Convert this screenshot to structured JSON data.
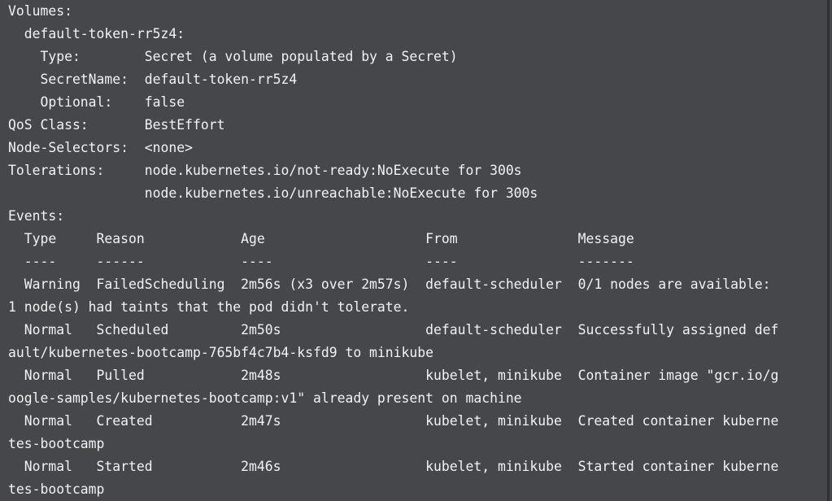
{
  "terminal": {
    "lines": [
      "Volumes:",
      "  default-token-rr5z4:",
      "    Type:        Secret (a volume populated by a Secret)",
      "    SecretName:  default-token-rr5z4",
      "    Optional:    false",
      "QoS Class:       BestEffort",
      "Node-Selectors:  <none>",
      "Tolerations:     node.kubernetes.io/not-ready:NoExecute for 300s",
      "                 node.kubernetes.io/unreachable:NoExecute for 300s",
      "Events:",
      "  Type     Reason            Age                    From               Message",
      "  ----     ------            ----                   ----               -------",
      "  Warning  FailedScheduling  2m56s (x3 over 2m57s)  default-scheduler  0/1 nodes are available:",
      "1 node(s) had taints that the pod didn't tolerate.",
      "  Normal   Scheduled         2m50s                  default-scheduler  Successfully assigned def",
      "ault/kubernetes-bootcamp-765bf4c7b4-ksfd9 to minikube",
      "  Normal   Pulled            2m48s                  kubelet, minikube  Container image \"gcr.io/g",
      "oogle-samples/kubernetes-bootcamp:v1\" already present on machine",
      "  Normal   Created           2m47s                  kubelet, minikube  Created container kuberne",
      "tes-bootcamp",
      "  Normal   Started           2m46s                  kubelet, minikube  Started container kuberne",
      "tes-bootcamp"
    ]
  },
  "colors": {
    "background": "#45474b",
    "text": "#f2f2f2"
  }
}
